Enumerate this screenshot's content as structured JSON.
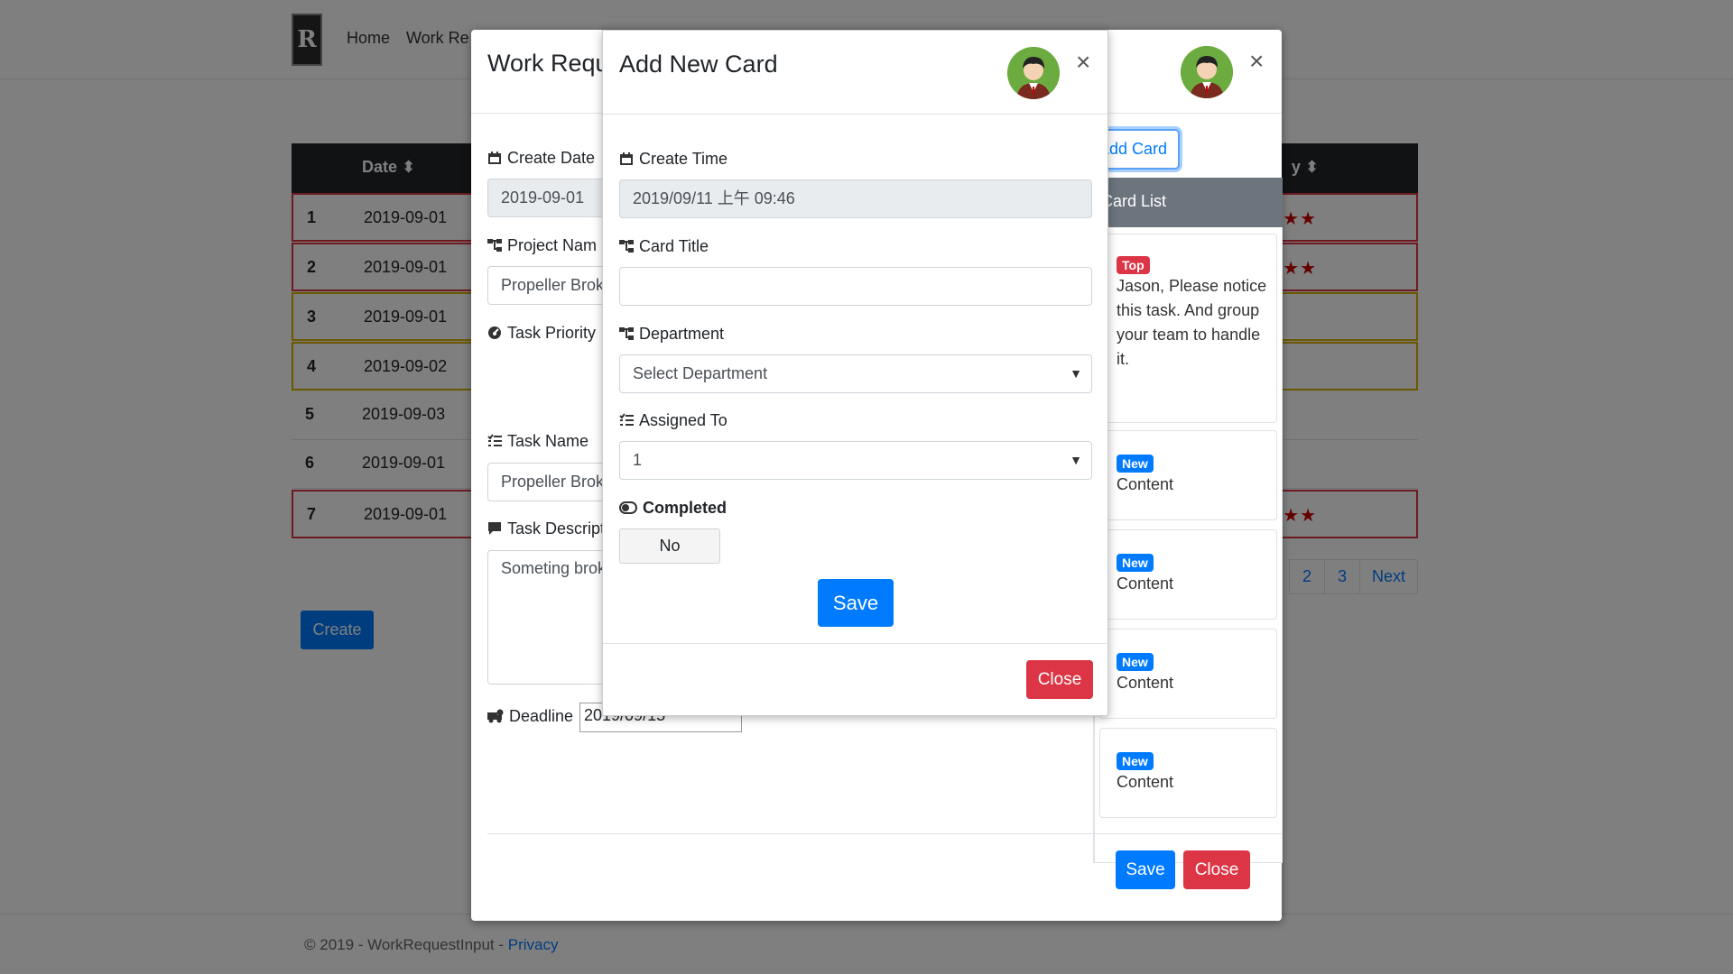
{
  "nav": {
    "logo_text": "R",
    "links": [
      "Home",
      "Work Re"
    ]
  },
  "table": {
    "header": {
      "date": "Date ⬍",
      "priority": "y ⬍"
    },
    "rows": [
      {
        "num": "1",
        "date": "2019-09-01",
        "stars": "★★"
      },
      {
        "num": "2",
        "date": "2019-09-01",
        "stars": "★★"
      },
      {
        "num": "3",
        "date": "2019-09-01",
        "stars": ""
      },
      {
        "num": "4",
        "date": "2019-09-02",
        "stars": ""
      },
      {
        "num": "5",
        "date": "2019-09-03",
        "stars": ""
      },
      {
        "num": "6",
        "date": "2019-09-01",
        "stars": ""
      },
      {
        "num": "7",
        "date": "2019-09-01",
        "stars": "★★"
      }
    ]
  },
  "page": {
    "create_label": "Create"
  },
  "pagination": {
    "p2": "2",
    "p3": "3",
    "next": "Next"
  },
  "footer": {
    "text": "© 2019 - WorkRequestInput - ",
    "privacy": "Privacy"
  },
  "work_modal": {
    "title": "Work Requ",
    "close": "×",
    "create_date_label": "Create Date",
    "create_date_value": "2019-09-01",
    "project_label": "Project Nam",
    "project_value": "Propeller Brok",
    "priority_label": "Task Priority",
    "task_name_label": "Task Name",
    "task_name_value": "Propeller Brok",
    "task_desc_label": "Task Descript",
    "task_desc_value": "Someting brok",
    "deadline_label": "Deadline",
    "deadline_value": "2019/09/15",
    "add_card": "Add Card",
    "card_list_header": "Card List",
    "cards": [
      {
        "badge": "Top",
        "text": "Jason, Please notice this task. And group your team to handle it."
      },
      {
        "badge": "New",
        "text": "Content"
      },
      {
        "badge": "New",
        "text": "Content"
      },
      {
        "badge": "New",
        "text": "Content"
      },
      {
        "badge": "New",
        "text": "Content"
      }
    ],
    "save": "Save",
    "close_btn": "Close"
  },
  "card_modal": {
    "title": "Add New Card",
    "close": "×",
    "create_time_label": "Create Time",
    "create_time_value": "2019/09/11 上午 09:46",
    "card_title_label": "Card Title",
    "card_title_value": "",
    "department_label": "Department",
    "department_value": "Select Department",
    "assigned_label": "Assigned To",
    "assigned_value": "1",
    "completed_label": "Completed",
    "completed_value": "No",
    "save": "Save",
    "close_btn": "Close"
  },
  "colors": {
    "primary": "#007bff",
    "danger": "#dc3545",
    "dark": "#212529",
    "secondary": "#6c757d",
    "star": "#cc0000",
    "avatar_bg": "#6cab3f"
  }
}
